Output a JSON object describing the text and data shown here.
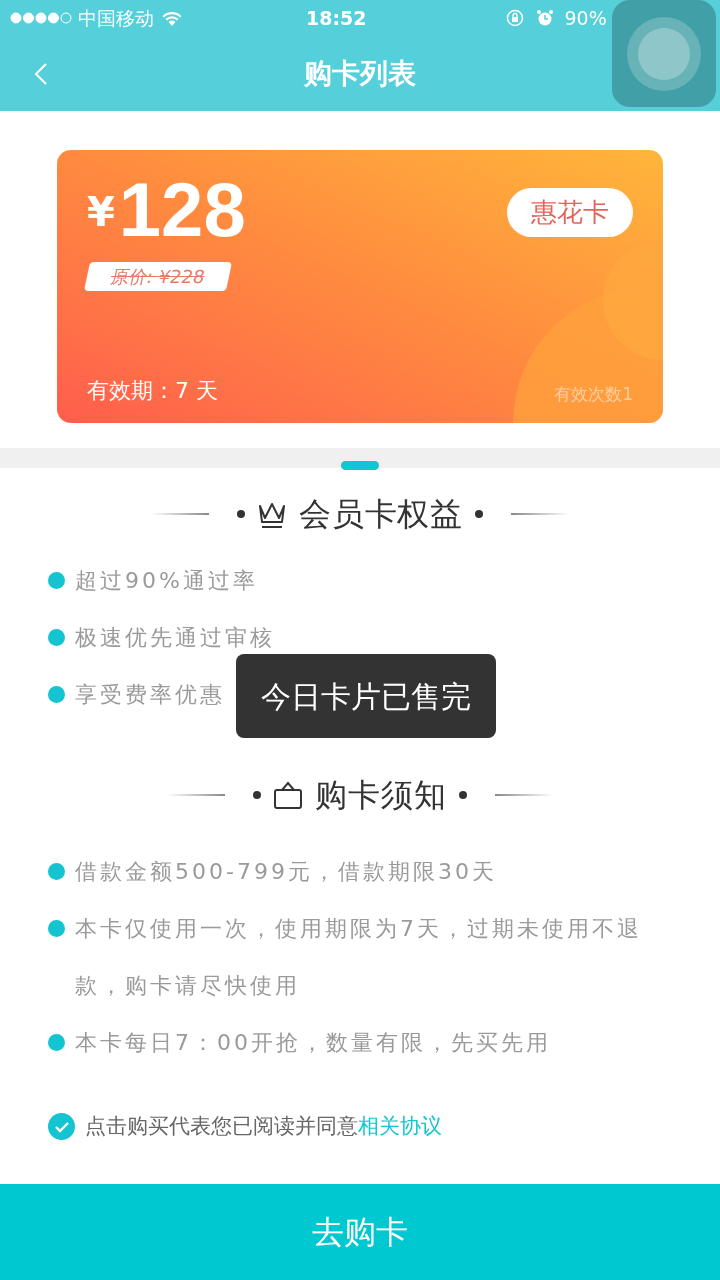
{
  "status_bar": {
    "carrier": "中国移动",
    "time": "18:52",
    "battery": "90%"
  },
  "nav": {
    "title": "购卡列表"
  },
  "card": {
    "currency": "¥",
    "price": "128",
    "original_price": "原价: ¥228",
    "badge": "惠花卡",
    "validity": "有效期：7 天",
    "uses": "有效次数1"
  },
  "benefits": {
    "title": "会员卡权益",
    "items": [
      "超过90%通过率",
      "极速优先通过审核",
      "享受费率优惠"
    ]
  },
  "notice": {
    "title": "购卡须知",
    "items": [
      "借款金额500-799元，借款期限30天",
      "本卡仅使用一次，使用期限为7天，过期未使用不退款，购卡请尽快使用",
      "本卡每日7：00开抢，数量有限，先买先用"
    ]
  },
  "agreement": {
    "checked": true,
    "text": "点击购买代表您已阅读并同意",
    "link": "相关协议"
  },
  "toast": "今日卡片已售完",
  "buy_button": "去购卡"
}
